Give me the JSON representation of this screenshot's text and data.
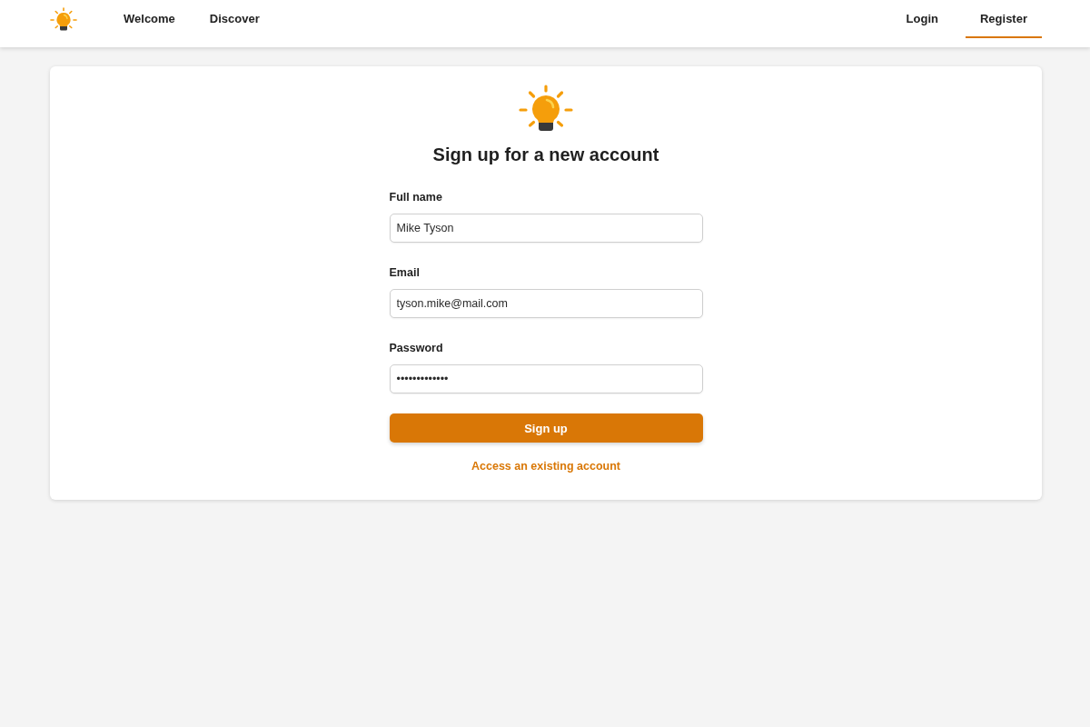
{
  "nav": {
    "left_items": [
      {
        "label": "Welcome",
        "selected": false
      },
      {
        "label": "Discover",
        "selected": false
      }
    ],
    "right_items": [
      {
        "label": "Login",
        "selected": false
      },
      {
        "label": "Register",
        "selected": true
      }
    ]
  },
  "form": {
    "title": "Sign up for a new account",
    "fields": [
      {
        "label": "Full name",
        "value": "Mike Tyson"
      },
      {
        "label": "Email",
        "value": "tyson.mike@mail.com"
      },
      {
        "label": "Password",
        "value": "•••••••••••••"
      }
    ],
    "submit": "Sign up",
    "link": "Access an existing account"
  }
}
